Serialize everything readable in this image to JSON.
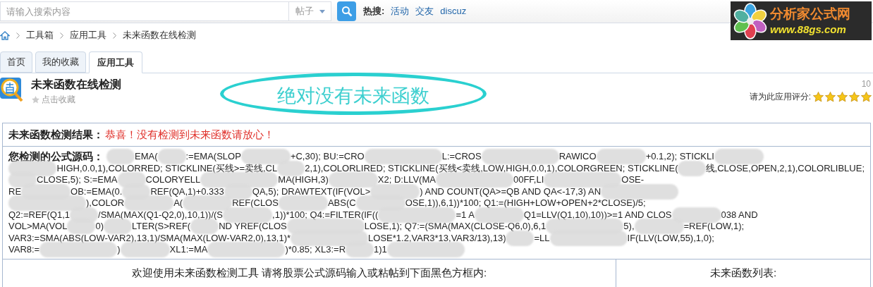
{
  "search": {
    "placeholder": "请输入搜索内容",
    "scope": "帖子",
    "hot_label": "热搜:",
    "hot_links": [
      "活动",
      "交友",
      "discuz"
    ]
  },
  "logo": {
    "title": "分析家公式网",
    "url": "www.88gs.com"
  },
  "breadcrumb": [
    "工具箱",
    "应用工具",
    "未来函数在线检测"
  ],
  "tabs": [
    {
      "label": "首页",
      "selected": false
    },
    {
      "label": "我的收藏",
      "selected": false
    },
    {
      "label": "应用工具",
      "selected": true
    }
  ],
  "app": {
    "title": "未来函数在线检测",
    "favorite": "点击收藏",
    "count": "10",
    "rating_label": "请为此应用评分:",
    "stars": 5
  },
  "annotation": {
    "text": "绝对没有未来函数"
  },
  "result": {
    "label": "未来函数检测结果：",
    "message": "恭喜！没有检测到未来函数请放心！"
  },
  "source": {
    "label": "您检测的公式源码：",
    "lines": [
      [
        {
          "kind": "blur_s"
        },
        {
          "kind": "text",
          "text": "EMA("
        },
        {
          "kind": "blur_s"
        },
        {
          "kind": "text",
          "text": ":=EMA(SLOP"
        },
        {
          "kind": "blur_m"
        },
        {
          "kind": "text",
          "text": "+C,30); BU:=CRO"
        },
        {
          "kind": "blur_l"
        },
        {
          "kind": "text",
          "text": "L:=CROS"
        },
        {
          "kind": "blur_l"
        },
        {
          "kind": "text",
          "text": "RAWICO"
        },
        {
          "kind": "blur_m"
        },
        {
          "kind": "text",
          "text": "+0.1,2); STICKLI"
        },
        {
          "kind": "blur_m"
        }
      ],
      [
        {
          "kind": "blur_m"
        },
        {
          "kind": "text",
          "text": "HIGH,0.0,1),COLORRED; STICKLINE(买线>=卖线,CL"
        },
        {
          "kind": "blur_s"
        },
        {
          "kind": "text",
          "text": "2,1),COLORLIRED; STICKLINE(买线<卖线,LOW,HIGH,0.0,1),COLORGREEN; STICKLINE("
        },
        {
          "kind": "blur_s"
        },
        {
          "kind": "text",
          "text": "线,CLOSE,OPEN,2,1),COLORLIBLUE;"
        }
      ],
      [
        {
          "kind": "blur_s"
        },
        {
          "kind": "text",
          "text": "CLOSE,5); S:=EMA"
        },
        {
          "kind": "blur_s"
        },
        {
          "kind": "text",
          "text": "COLORYELL"
        },
        {
          "kind": "blur_l"
        },
        {
          "kind": "text",
          "text": "MA(HIGH,3)"
        },
        {
          "kind": "blur_m"
        },
        {
          "kind": "text",
          "text": "X2; D:LLV(MA"
        },
        {
          "kind": "blur_l"
        },
        {
          "kind": "text",
          "text": "00FF,LI"
        },
        {
          "kind": "blur_l"
        },
        {
          "kind": "text",
          "text": "OSE-"
        }
      ],
      [
        {
          "kind": "text",
          "text": "RE"
        },
        {
          "kind": "blur_m"
        },
        {
          "kind": "text",
          "text": "OB:=EMA(0."
        },
        {
          "kind": "blur_s"
        },
        {
          "kind": "text",
          "text": "REF(QA,1)+0.333"
        },
        {
          "kind": "blur_s"
        },
        {
          "kind": "text",
          "text": "QA,5); DRAWTEXT(IF(VOL>"
        },
        {
          "kind": "blur_m"
        },
        {
          "kind": "text",
          "text": ") AND COUNT(QA>=QB AND QA<-17,3) AN"
        },
        {
          "kind": "blur_l"
        }
      ],
      [
        {
          "kind": "blur_l"
        },
        {
          "kind": "text",
          "text": "),COLOR"
        },
        {
          "kind": "blur_m"
        },
        {
          "kind": "text",
          "text": "A("
        },
        {
          "kind": "blur_m"
        },
        {
          "kind": "text",
          "text": "REF(CLOS"
        },
        {
          "kind": "blur_m"
        },
        {
          "kind": "text",
          "text": "ABS(C"
        },
        {
          "kind": "blur_m"
        },
        {
          "kind": "text",
          "text": "OSE,1)),6,1))*100; Q1:=(HIGH+LOW+OPEN+2*CLOSE)/5;"
        }
      ],
      [
        {
          "kind": "text",
          "text": "Q2:=REF(Q1,1"
        },
        {
          "kind": "blur_s"
        },
        {
          "kind": "text",
          "text": "/SMA(MAX(Q1-Q2,0),10,1))/(S"
        },
        {
          "kind": "blur_m"
        },
        {
          "kind": "text",
          "text": ",1))*100; Q4:=FILTER(IF(("
        },
        {
          "kind": "blur_l"
        },
        {
          "kind": "text",
          "text": "=1 A"
        },
        {
          "kind": "blur_m"
        },
        {
          "kind": "text",
          "text": "Q1=LLV(Q1,10),10))>=1 AND CLOS"
        },
        {
          "kind": "blur_m"
        },
        {
          "kind": "text",
          "text": "038 AND"
        }
      ],
      [
        {
          "kind": "text",
          "text": "VOL>MA(VOL"
        },
        {
          "kind": "blur_s"
        },
        {
          "kind": "text",
          "text": "0)"
        },
        {
          "kind": "blur_s"
        },
        {
          "kind": "text",
          "text": "LTER(S>REF("
        },
        {
          "kind": "blur_s"
        },
        {
          "kind": "text",
          "text": "ND YREF(CLOS"
        },
        {
          "kind": "blur_l"
        },
        {
          "kind": "text",
          "text": "LOSE,1); Q7:=(SMA(MAX(CLOSE-Q6,0),6,1"
        },
        {
          "kind": "blur_l"
        },
        {
          "kind": "text",
          "text": "5),"
        },
        {
          "kind": "blur_m"
        },
        {
          "kind": "text",
          "text": "=REF(LOW,1);"
        }
      ],
      [
        {
          "kind": "text",
          "text": "VAR3:=SMA(ABS(LOW-VAR2),13,1)/SMA(MAX(LOW-VAR2,0),13,1)*"
        },
        {
          "kind": "blur_l"
        },
        {
          "kind": "text",
          "text": "LOSE*1.2,VAR3*13,VAR3/13),13)"
        },
        {
          "kind": "blur_s"
        },
        {
          "kind": "text",
          "text": "=LL"
        },
        {
          "kind": "blur_l"
        },
        {
          "kind": "text",
          "text": "IF(LLV(LOW,55),1,0);"
        }
      ],
      [
        {
          "kind": "text",
          "text": "VAR8:="
        },
        {
          "kind": "blur_l"
        },
        {
          "kind": "text",
          "text": ")"
        },
        {
          "kind": "blur_m"
        },
        {
          "kind": "text",
          "text": "XL1:=MA"
        },
        {
          "kind": "blur_l"
        },
        {
          "kind": "text",
          "text": ")*0.85; XL3:=R"
        },
        {
          "kind": "blur_s"
        },
        {
          "kind": "text",
          "text": "1)1"
        },
        {
          "kind": "blur_l"
        }
      ]
    ]
  },
  "table": {
    "columns": [
      "欢迎使用未来函数检测工具 请将股票公式源码输入或粘帖到下面黑色方框内:",
      "未来函数列表:"
    ]
  }
}
